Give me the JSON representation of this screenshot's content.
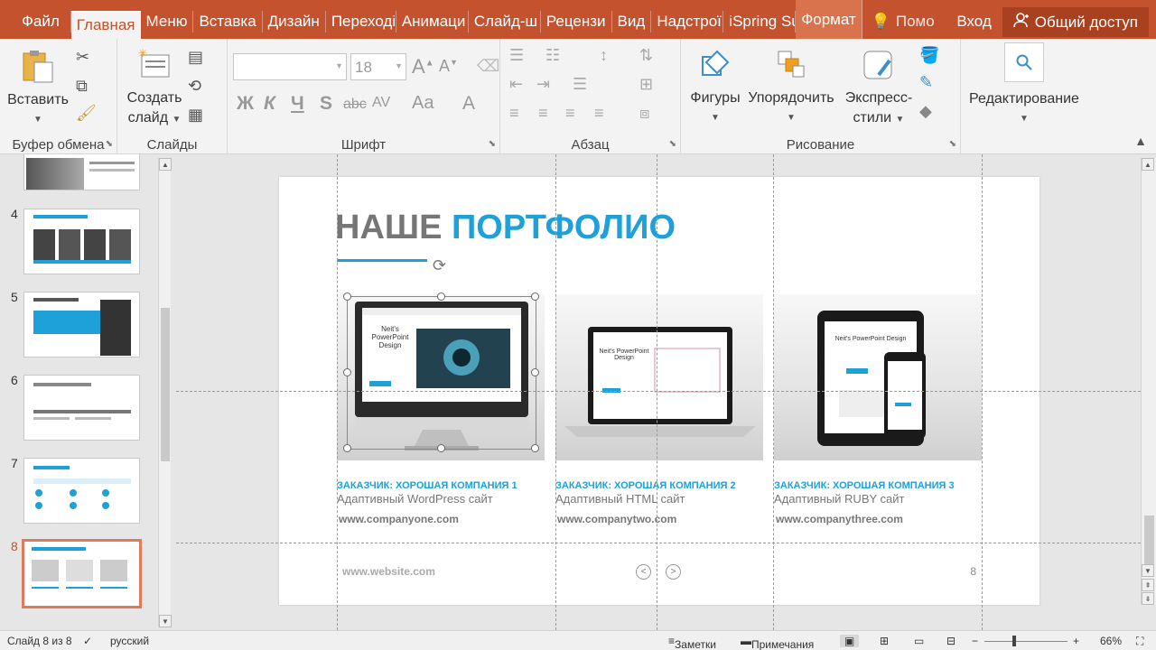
{
  "tabs": {
    "file": "Файл",
    "home": "Главная",
    "menu": "Меню",
    "insert": "Вставка",
    "design": "Дизайн",
    "transitions": "Переході",
    "animations": "Анимаци",
    "slideshow": "Слайд-ш",
    "review": "Рецензи",
    "view": "Вид",
    "addins": "Надстрої",
    "ispring": "iSpring Su",
    "format": "Формат",
    "help": "Помо",
    "signin": "Вход",
    "share": "Общий доступ"
  },
  "ribbon": {
    "paste": "Вставить",
    "clipboard_group": "Буфер обмена",
    "new_slide_1": "Создать",
    "new_slide_2": "слайд",
    "slides_group": "Слайды",
    "font_size": "18",
    "bold": "Ж",
    "italic": "К",
    "underline": "Ч",
    "strike": "S",
    "strike2": "abc",
    "spacing": "AV",
    "case": "Aa",
    "font_color": "A",
    "font_group": "Шрифт",
    "paragraph_group": "Абзац",
    "shapes": "Фигуры",
    "arrange": "Упорядочить",
    "quick_styles_1": "Экспресс-",
    "quick_styles_2": "стили",
    "drawing_group": "Рисование",
    "editing": "Редактирование"
  },
  "thumbnails": {
    "n4": "4",
    "n5": "5",
    "n6": "6",
    "n7": "7",
    "n8": "8"
  },
  "slide": {
    "title_gray": "НАШЕ",
    "title_blue": "ПОРТФОЛИО",
    "client1": "ЗАКАЗЧИК: ХОРОШАЯ КОМПАНИЯ 1",
    "type1": "Адаптивный WordPress сайт",
    "url1": "www.companyone.com",
    "client2": "ЗАКАЗЧИК: ХОРОШАЯ КОМПАНИЯ 2",
    "type2": "Адаптивный HTML сайт",
    "url2": "www.companytwo.com",
    "client3": "ЗАКАЗЧИК: ХОРОШАЯ КОМПАНИЯ 3",
    "type3": "Адаптивный RUBY сайт",
    "url3": "www.companythree.com",
    "footer_url": "www.website.com",
    "page": "8",
    "prev": "<",
    "next": ">",
    "screen_text": "Neit's PowerPoint Design"
  },
  "status": {
    "slide_info": "Слайд 8 из 8",
    "language": "русский",
    "notes": "Заметки",
    "comments": "Примечания",
    "zoom": "66%"
  },
  "colors": {
    "accent": "#c4522e",
    "slide_blue": "#1da1d8"
  }
}
